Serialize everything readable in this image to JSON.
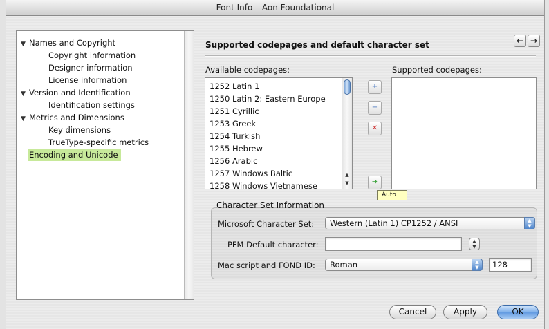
{
  "window": {
    "title": "Font Info – Aon Foundational"
  },
  "tree": {
    "items": [
      {
        "label": "Names and Copyright",
        "level": "group",
        "expanded": true
      },
      {
        "label": "Copyright information",
        "level": "child"
      },
      {
        "label": "Designer information",
        "level": "child"
      },
      {
        "label": "License information",
        "level": "child"
      },
      {
        "label": "Version and Identification",
        "level": "group",
        "expanded": true
      },
      {
        "label": "Identification settings",
        "level": "child"
      },
      {
        "label": "Metrics and Dimensions",
        "level": "group",
        "expanded": true
      },
      {
        "label": "Key dimensions",
        "level": "child"
      },
      {
        "label": "TrueType-specific metrics",
        "level": "child"
      },
      {
        "label": "Encoding and Unicode",
        "level": "plain",
        "selected": true
      }
    ]
  },
  "header": {
    "title": "Supported codepages and  default character set",
    "back_icon": "arrow-left-icon",
    "forward_icon": "arrow-right-icon"
  },
  "available": {
    "label": "Available codepages:",
    "items": [
      {
        "code": "1252",
        "name": "Latin 1"
      },
      {
        "code": "1250",
        "name": "Latin 2: Eastern Europe"
      },
      {
        "code": "1251",
        "name": "Cyrillic"
      },
      {
        "code": "1253",
        "name": "Greek"
      },
      {
        "code": "1254",
        "name": "Turkish"
      },
      {
        "code": "1255",
        "name": "Hebrew"
      },
      {
        "code": "1256",
        "name": "Arabic"
      },
      {
        "code": "1257",
        "name": "Windows Baltic"
      },
      {
        "code": "1258",
        "name": "Windows Vietnamese"
      }
    ]
  },
  "supported": {
    "label": "Supported codepages:",
    "items": []
  },
  "transfer_buttons": {
    "add_icon": "plus-icon",
    "remove_icon": "minus-icon",
    "clear_icon": "x-icon",
    "auto_icon": "auto-arrow-icon",
    "auto_tooltip": "Auto"
  },
  "charset": {
    "group_label": "Character Set Information",
    "ms_label": "Microsoft Character Set:",
    "ms_value": "Western (Latin 1) CP1252 / ANSI",
    "pfm_label": "PFM Default character:",
    "pfm_value": "",
    "mac_label": "Mac script and FOND ID:",
    "mac_value": "Roman",
    "fond_id": "128"
  },
  "buttons": {
    "cancel": "Cancel",
    "apply": "Apply",
    "ok": "OK"
  }
}
